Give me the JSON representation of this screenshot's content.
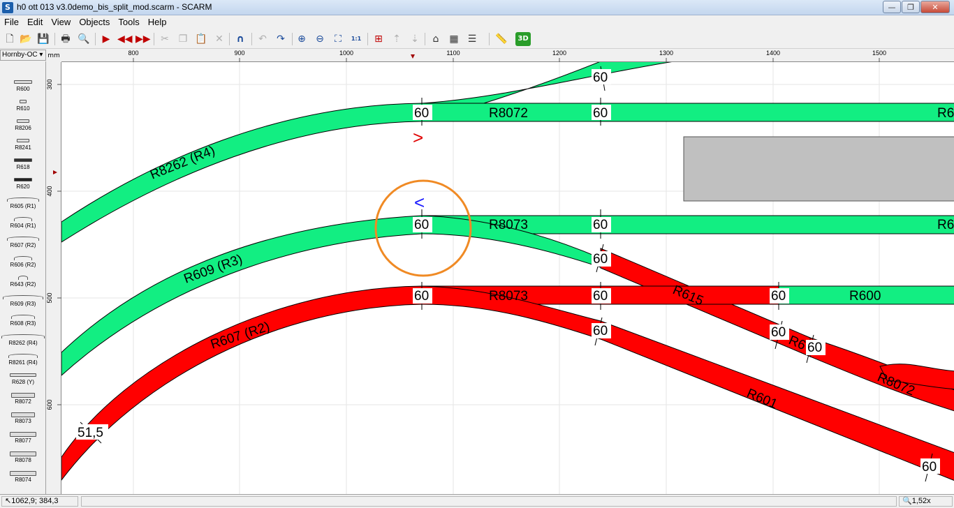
{
  "window": {
    "title": "h0 ott 013 v3.0demo_bis_split_mod.scarm - SCARM",
    "app_icon": "S",
    "minimize": "—",
    "maximize": "❐",
    "close": "✕"
  },
  "menu": [
    "File",
    "Edit",
    "View",
    "Objects",
    "Tools",
    "Help"
  ],
  "toolbar": {
    "icons": [
      "new-file-icon",
      "open-folder-icon",
      "save-icon",
      "print-icon",
      "print-preview-icon",
      "play-forward-icon",
      "step-back-icon",
      "step-forward-icon",
      "cut-icon",
      "copy-icon",
      "paste-icon",
      "delete-icon",
      "magnet-icon",
      "undo-icon",
      "redo-icon",
      "zoom-in-icon",
      "zoom-out-icon",
      "zoom-fit-icon",
      "zoom-1to1-icon",
      "flex-track-icon",
      "layer-up-icon",
      "layer-down-icon",
      "bridge-icon",
      "tunnel-icon",
      "grid-icon",
      "measure-icon",
      "3d-view-icon"
    ],
    "three_d_label": "3D",
    "one_to_one_label": "1:1"
  },
  "library": {
    "selected": "Hornby-OC",
    "items": [
      "R600",
      "R610",
      "R8206",
      "R8241",
      "R618",
      "R620",
      "R605 (R1)",
      "R604 (R1)",
      "R607 (R2)",
      "R606 (R2)",
      "R643 (R2)",
      "R609 (R3)",
      "R608 (R3)",
      "R8262 (R4)",
      "R8261 (R4)",
      "R628 (Y)",
      "R8072",
      "R8073",
      "R8077",
      "R8078",
      "R8074"
    ]
  },
  "ruler": {
    "unit": "mm",
    "h_ticks": [
      "800",
      "900",
      "1000",
      "1100",
      "1200",
      "1300",
      "1400",
      "1500"
    ],
    "v_ticks": [
      "300",
      "400",
      "500",
      "600"
    ]
  },
  "canvas": {
    "colors": {
      "green_track": "#12ee82",
      "red_track": "#ff0000",
      "building": "#c0c0c0",
      "highlight": "#f08a24",
      "arrow_forward": "#e00000",
      "arrow_back": "#1a1aff"
    },
    "track_labels": [
      "R8262 (R4)",
      "R8072",
      "R609 (R3)",
      "R8073",
      "R607 (R2)",
      "R8073",
      "R615",
      "R600",
      "R601",
      "R8072",
      "R6",
      "R6",
      "R6"
    ],
    "dimension_labels": [
      "60",
      "60",
      "60",
      "60",
      "60",
      "60",
      "60",
      "60",
      "60",
      "60",
      "60",
      "60",
      "60",
      "60",
      "51,5"
    ],
    "arrow_forward": ">",
    "arrow_back": "<"
  },
  "status": {
    "coords": "1062,9; 384,3",
    "zoom": "1,52x"
  }
}
